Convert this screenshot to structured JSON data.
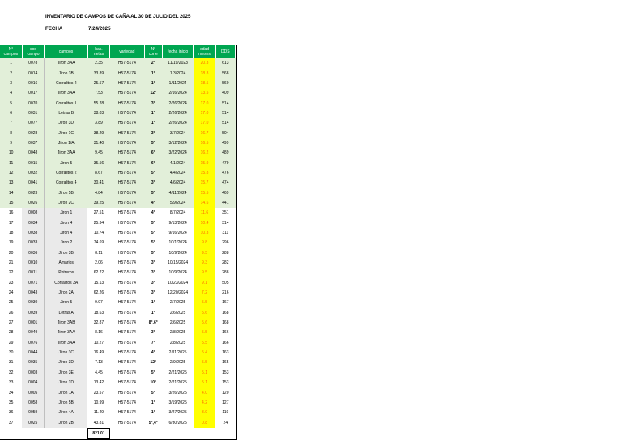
{
  "header": {
    "title": "INVENTARIO DE CAMPOS DE CAÑA AL 30 DE JULIO DEL 2025",
    "fecha_label": "FECHA",
    "fecha_value": "7/24/2025"
  },
  "columns": [
    [
      "N°",
      "campos"
    ],
    [
      "cod",
      "campo"
    ],
    [
      "campos",
      ""
    ],
    [
      "has.",
      "netas"
    ],
    [
      "variedad",
      ""
    ],
    [
      "N°",
      "corte"
    ],
    [
      "fecha inicio",
      ""
    ],
    [
      "edad",
      "meses"
    ],
    [
      "DDS",
      ""
    ]
  ],
  "rows": [
    [
      "1",
      "0078",
      "Jiron 3AA",
      "2.35",
      "H57-5174",
      "2°",
      "11/19/2023",
      "20.3",
      "613"
    ],
    [
      "2",
      "0014",
      "Jiron 3B",
      "33.89",
      "H57-5174",
      "1°",
      "1/3/2024",
      "18.8",
      "568"
    ],
    [
      "3",
      "0016",
      "Corralitos 2",
      "25.57",
      "H57-5174",
      "1°",
      "1/11/2024",
      "18.5",
      "560"
    ],
    [
      "4",
      "0017",
      "Jiron 3AA",
      "7.53",
      "H57-5174",
      "12°",
      "2/16/2024",
      "13.5",
      "409"
    ],
    [
      "5",
      "0070",
      "Corralitos 1",
      "55.28",
      "H57-5174",
      "3°",
      "2/26/2024",
      "17.0",
      "514"
    ],
    [
      "6",
      "0031",
      "Letras B",
      "38.03",
      "H57-5174",
      "1°",
      "2/26/2024",
      "17.0",
      "514"
    ],
    [
      "7",
      "0077",
      "Jiron 3D",
      "3.89",
      "H57-5174",
      "1°",
      "2/26/2024",
      "17.0",
      "514"
    ],
    [
      "8",
      "0028",
      "Jiron 1C",
      "38.29",
      "H57-5174",
      "3°",
      "3/7/2024",
      "16.7",
      "504"
    ],
    [
      "9",
      "0037",
      "Jiron 1/A",
      "31.40",
      "H57-5174",
      "5°",
      "3/12/2024",
      "16.5",
      "499"
    ],
    [
      "10",
      "0048",
      "Jiron 3AA",
      "9.45",
      "H57-5174",
      "6°",
      "3/22/2024",
      "16.2",
      "489"
    ],
    [
      "11",
      "0015",
      "Jiron 5",
      "35.56",
      "H57-5174",
      "6°",
      "4/1/2024",
      "15.9",
      "479"
    ],
    [
      "12",
      "0032",
      "Corralitos 2",
      "8.67",
      "H57-5174",
      "5°",
      "4/4/2024",
      "15.8",
      "476"
    ],
    [
      "13",
      "0041",
      "Corralitos 4",
      "30.41",
      "H57-5174",
      "3°",
      "4/6/2024",
      "15.7",
      "474"
    ],
    [
      "14",
      "0023",
      "Jiron 5B",
      "4.84",
      "H57-5174",
      "5°",
      "4/11/2024",
      "15.5",
      "469"
    ],
    [
      "15",
      "0026",
      "Jiron 2C",
      "39.25",
      "H57-5174",
      "4°",
      "5/9/2024",
      "14.6",
      "441"
    ],
    [
      "16",
      "0008",
      "Jiron 1",
      "27.51",
      "H57-5174",
      "4°",
      "8/7/2024",
      "11.6",
      "351"
    ],
    [
      "17",
      "0034",
      "Jiron 4",
      "25.34",
      "H57-5174",
      "5°",
      "9/13/2024",
      "10.4",
      "314"
    ],
    [
      "18",
      "0038",
      "Jiron 4",
      "10.74",
      "H57-5174",
      "5°",
      "9/16/2024",
      "10.3",
      "311"
    ],
    [
      "19",
      "0033",
      "Jiron 2",
      "74.69",
      "H57-5174",
      "5°",
      "10/1/2024",
      "9.8",
      "296"
    ],
    [
      "20",
      "0036",
      "Jiron 3B",
      "8.11",
      "H57-5174",
      "5°",
      "10/9/2024",
      "9.5",
      "288"
    ],
    [
      "21",
      "0010",
      "Amarios",
      "2.06",
      "H57-5174",
      "3°",
      "10/15/2024",
      "9.3",
      "282"
    ],
    [
      "22",
      "0011",
      "Potreros",
      "62.22",
      "H57-5174",
      "3°",
      "10/9/2024",
      "9.5",
      "288"
    ],
    [
      "23",
      "0071",
      "Corralitos 3A",
      "15.13",
      "H57-5174",
      "3°",
      "10/23/2024",
      "9.1",
      "505"
    ],
    [
      "24",
      "0043",
      "Jiron 2A",
      "62.26",
      "H57-5174",
      "3°",
      "12/20/2024",
      "7.2",
      "216"
    ],
    [
      "25",
      "0030",
      "Jiron 5",
      "9.97",
      "H57-5174",
      "1°",
      "2/7/2025",
      "5.5",
      "167"
    ],
    [
      "26",
      "0039",
      "Letras A",
      "18.63",
      "H57-5174",
      "1°",
      "2/6/2025",
      "5.6",
      "168"
    ],
    [
      "27",
      "0001",
      "Jiron 3AB",
      "32.87",
      "H57-5174",
      "8°,6°",
      "2/6/2025",
      "5.6",
      "168"
    ],
    [
      "28",
      "0049",
      "Jiron 3AA",
      "8.16",
      "H57-5174",
      "3°",
      "2/8/2025",
      "5.5",
      "166"
    ],
    [
      "29",
      "0076",
      "Jiron 3AA",
      "10.27",
      "H57-5174",
      "7°",
      "2/8/2025",
      "5.5",
      "166"
    ],
    [
      "30",
      "0044",
      "Jiron 3C",
      "16.49",
      "H57-5174",
      "4°",
      "2/11/2025",
      "5.4",
      "163"
    ],
    [
      "31",
      "0035",
      "Jiron 3D",
      "7.13",
      "H57-5174",
      "12°",
      "2/9/2025",
      "5.5",
      "165"
    ],
    [
      "32",
      "0003",
      "Jiron 3E",
      "4.45",
      "H57-5174",
      "5°",
      "2/21/2025",
      "5.1",
      "153"
    ],
    [
      "33",
      "0004",
      "Jiron 1D",
      "13.42",
      "H57-5174",
      "10°",
      "2/21/2025",
      "5.1",
      "153"
    ],
    [
      "34",
      "0005",
      "Jiron 1A",
      "23.57",
      "H57-5174",
      "5°",
      "3/26/2025",
      "4.0",
      "120"
    ],
    [
      "35",
      "0058",
      "Jiron 5B",
      "10.99",
      "H57-5174",
      "1°",
      "3/19/2025",
      "4.2",
      "127"
    ],
    [
      "36",
      "0059",
      "Jiron 4A",
      "11.49",
      "H57-5174",
      "1°",
      "3/27/2025",
      "3.9",
      "119"
    ],
    [
      "37",
      "0025",
      "Jiron 2B",
      "43.81",
      "H57-5174",
      "5°,4°",
      "6/30/2025",
      "0.8",
      "24"
    ]
  ],
  "green_rows_count": 15,
  "total": {
    "has_netas": "821.01"
  },
  "colors": {
    "header_green": "#00a651",
    "row_green": "#e2efd9",
    "edad_yellow": "#ffff00",
    "edad_text": "#ff6a00"
  }
}
